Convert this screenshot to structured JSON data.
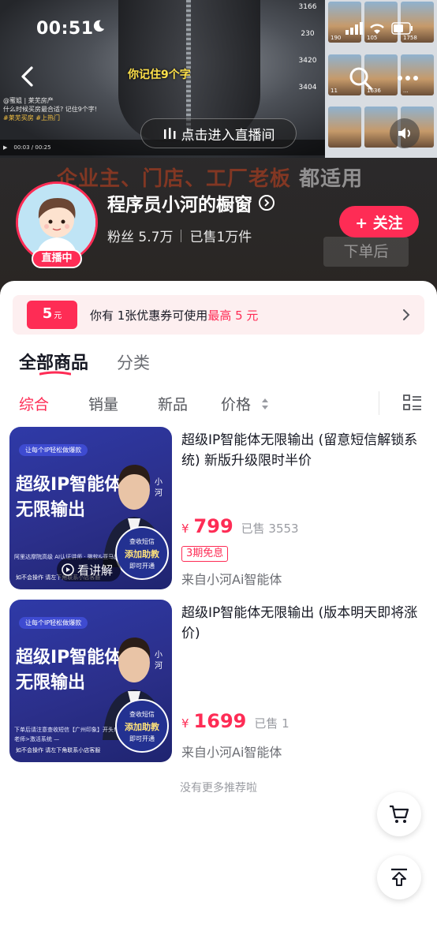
{
  "status_bar": {
    "time": "00:51"
  },
  "video": {
    "caption": "你记住9个字",
    "meta_lines": [
      "@蜜姐 | 莱芜房产",
      "什么时候买房最合适? 记住9个字!",
      "#莱芜买房 #上热门"
    ],
    "stats": [
      "3166",
      "230",
      "3420",
      "3404"
    ],
    "thumb_counts": [
      "190",
      "105",
      "1758",
      "11",
      "1636",
      "..."
    ],
    "live_entry_label": "点击进入直播间"
  },
  "banner": {
    "red_text": "企业主、门店、工厂老板",
    "white_text": "都适用",
    "ghost_button": "下单后"
  },
  "shop": {
    "name": "程序员小河的橱窗",
    "live_badge": "直播中",
    "fans": "粉丝 5.7万",
    "sold": "已售1万件",
    "follow_label": "+ 关注"
  },
  "coupon": {
    "amount": "5",
    "unit": "元",
    "text_prefix": "你有 1张优惠券可使用",
    "text_highlight": "最高 5 元"
  },
  "tabs": {
    "all": "全部商品",
    "category": "分类"
  },
  "sort": {
    "items": [
      "综合",
      "销量",
      "新品",
      "价格"
    ]
  },
  "products": [
    {
      "title": "超级IP智能体无限输出 (留意短信解锁系统) 新版升级限时半价",
      "price_symbol": "¥",
      "price": "799",
      "sold": "已售 3553",
      "tag": "3期免息",
      "from": "来自小河Ai智能体",
      "image": {
        "pill": "让每个IP轻松做爆款",
        "headline_1": "超级IP智能体",
        "headline_2": "无限输出",
        "name_vertical": "小河",
        "badge_1": "查收短信",
        "badge_2": "添加助教",
        "badge_3": "即可开通",
        "strip": "阿里达摩院高级 AI认证讲师 · 微软&亚马逊商业 AI认证讲师",
        "note": "如不会操作 请左下角联系小店客服",
        "watch": "看讲解"
      }
    },
    {
      "title": "超级IP智能体无限输出 (版本明天即将涨价)",
      "price_symbol": "¥",
      "price": "1699",
      "sold": "已售 1",
      "from": "来自小河Ai智能体",
      "image": {
        "pill": "让每个IP轻松做爆款",
        "headline_1": "超级IP智能体",
        "headline_2": "无限输出",
        "name_vertical": "小河",
        "badge_1": "查收短信",
        "badge_2": "添加助教",
        "badge_3": "即可开通",
        "strip": "下单后请注意查收短信【广州印象】开头! — 点击添加<助教老师>激活系统 —",
        "note": "如不会操作 请左下角联系小店客服"
      }
    }
  ],
  "footer": {
    "no_more": "没有更多推荐啦"
  },
  "colors": {
    "accent": "#fe2c55",
    "sheet": "#ffffff",
    "coupon_bg": "#fdeff0",
    "product_bg": "#2b2f8a"
  },
  "icons": [
    "back-icon",
    "search-icon",
    "more-icon",
    "sound-icon",
    "chevron-right-icon",
    "sort-caret-icon",
    "layout-icon",
    "cart-icon",
    "back-to-top-icon"
  ]
}
